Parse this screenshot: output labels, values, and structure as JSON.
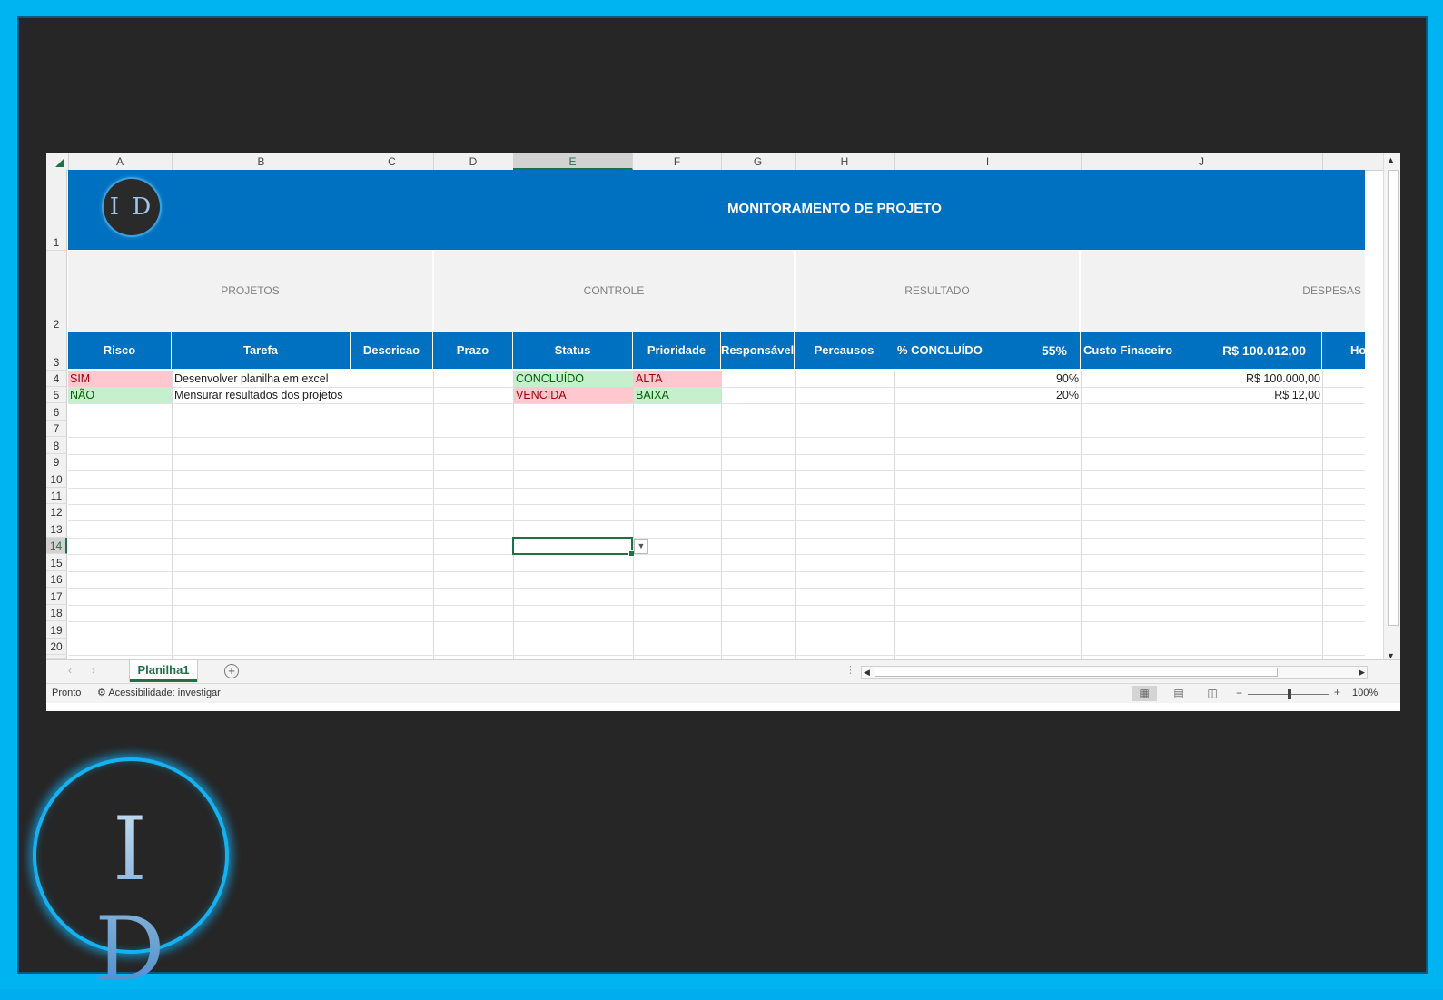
{
  "window": {
    "columns": [
      "A",
      "B",
      "C",
      "D",
      "E",
      "F",
      "G",
      "H",
      "I",
      "J"
    ],
    "selected_column": "E",
    "rows": [
      "1",
      "2",
      "3",
      "4",
      "5",
      "6",
      "7",
      "8",
      "9",
      "10",
      "11",
      "12",
      "13",
      "14",
      "15",
      "16",
      "17",
      "18",
      "19",
      "20"
    ],
    "selected_row": "14"
  },
  "banner": {
    "logo_text": "I D",
    "title": "MONITORAMENTO DE PROJETO"
  },
  "groups": [
    "PROJETOS",
    "CONTROLE",
    "RESULTADO",
    "DESPESAS"
  ],
  "headers": {
    "risco": "Risco",
    "tarefa": "Tarefa",
    "descricao": "Descricao",
    "prazo": "Prazo",
    "status": "Status",
    "prioridade": "Prioridade",
    "responsavel": "Responsável",
    "percausos": "Percausos",
    "concluido": "% CONCLUÍDO",
    "concluido_total": "55%",
    "custo": "Custo Finaceiro",
    "custo_total": "R$ 100.012,00",
    "next": "Ho"
  },
  "rows_data": [
    {
      "risco": "SIM",
      "risco_state": "red",
      "tarefa": "Desenvolver planilha em excel",
      "status": "CONCLUÍDO",
      "status_state": "green",
      "prioridade": "ALTA",
      "prioridade_state": "red",
      "percent": "90%",
      "custo": "R$ 100.000,00"
    },
    {
      "risco": "NÃO",
      "risco_state": "green",
      "tarefa": "Mensurar resultados dos projetos",
      "status": "VENCIDA",
      "status_state": "red",
      "prioridade": "BAIXA",
      "prioridade_state": "green",
      "percent": "20%",
      "custo": "R$ 12,00"
    }
  ],
  "tabs": {
    "sheet": "Planilha1",
    "add_icon": "plus-circle-icon"
  },
  "status": {
    "ready": "Pronto",
    "accessibility": "Acessibilidade: investigar",
    "zoom": "100%"
  },
  "brand": {
    "logo_text": "I D",
    "accent": "#00b4f2",
    "header_blue": "#0070c0",
    "excel_green": "#1e7145"
  }
}
